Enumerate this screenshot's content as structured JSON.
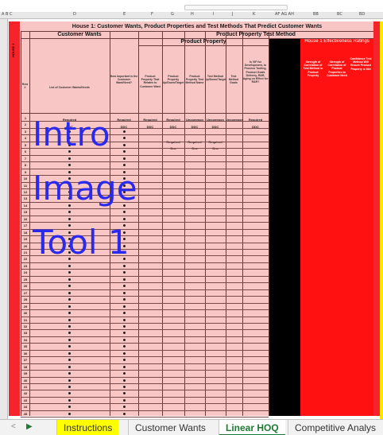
{
  "sheet": {
    "title": "House 1: Customer Wants, Product Properties and Test Methods That Predict Customer Wants",
    "section_left": "Customer Wants",
    "section_right": "Product Property Test Method",
    "product_property": "Product Property",
    "effectiveness": "House 1 Effectiveness Ratings",
    "house_label": "HOUSE 1",
    "headers": {
      "row_no": "Row #",
      "customer_wants": "List of Customer Wants/Needs",
      "importance": "How important is the Customer Want/Need?",
      "property_relates": "Product Property That Relates to Customer Want",
      "property_direction": "Product Property Up/Down/Target",
      "test_method": "Product Property Test Method Name",
      "test_direction": "Test Method Up/Down/Target",
      "test_goal": "Test Method Goals",
      "vif": "Is VIF for Development, to Process Tooling, Product Goals Delivery, R&R, Aging on Effect for R&R?",
      "strength": "Strength of Correlation of Test Method to Product Property",
      "strength_props": "Strength of Correlation of Product Properties to Customer Need",
      "confidence": "Confidence Test Method Will Ensure Product Property is Met"
    },
    "row1": {
      "label": "Required",
      "c2": "Required",
      "c3": "Required",
      "c4": "Required",
      "c5": "Uncommon",
      "c6": "Uncommon",
      "c7": "Uncommon",
      "c8": "Required"
    },
    "row2": {
      "label": "DDC",
      "c1": "DDC",
      "c2": "DDC",
      "c3": "DDC",
      "c4": "DDC",
      "c5": "DDC",
      "c6": "DDC"
    },
    "row4": {
      "c1": "Required",
      "c2": "Required",
      "c3": "Required"
    },
    "row5": {
      "c1": "One",
      "c2": "One",
      "c3": "One"
    },
    "row_numbers": [
      "1",
      "2",
      "3",
      "4",
      "5",
      "6",
      "7",
      "8",
      "9",
      "10",
      "11",
      "12",
      "13",
      "14",
      "15",
      "16",
      "17",
      "18",
      "19",
      "20",
      "21",
      "22",
      "23",
      "24",
      "25",
      "26",
      "27",
      "28",
      "29",
      "30",
      "31",
      "32",
      "33",
      "34",
      "35",
      "36",
      "37",
      "38",
      "39",
      "40",
      "41",
      "42",
      "43",
      "44",
      "45",
      "46"
    ]
  },
  "overlay": {
    "line1": "Intro",
    "line2": "Image",
    "line3": "Tool 1"
  },
  "tabs": [
    {
      "label": "Instructions"
    },
    {
      "label": "Customer Wants"
    },
    {
      "label": "Linear HOQ"
    },
    {
      "label": "Competitive Analys"
    }
  ],
  "nav": {
    "prev": "<",
    "next": "▶"
  },
  "colors": {
    "red": "#ff1111",
    "pink": "#f9c6c6",
    "active_tab": "#1e7a32",
    "instructions_tab": "#ffff00",
    "overlay_text": "#2a2aee"
  }
}
